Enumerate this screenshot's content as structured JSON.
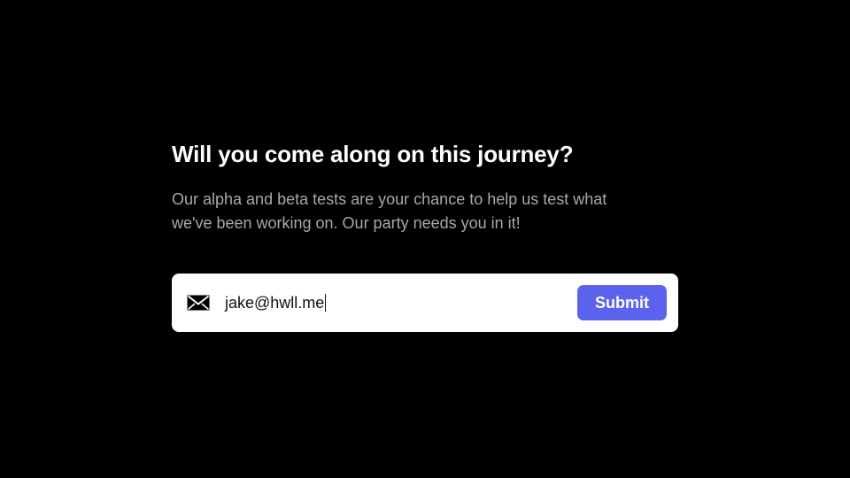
{
  "heading": {
    "title": "Will you come along on this journey?",
    "subtitle": "Our alpha and beta tests are your chance to help us test what we've been working on. Our party needs you in it!"
  },
  "signup": {
    "icon": "mail-icon",
    "email_value": "jake@hwll.me",
    "submit_label": "Submit"
  },
  "colors": {
    "background": "#000000",
    "title": "#ffffff",
    "subtitle": "#a8a8a8",
    "form_background": "#ffffff",
    "accent": "#5b63ee"
  }
}
